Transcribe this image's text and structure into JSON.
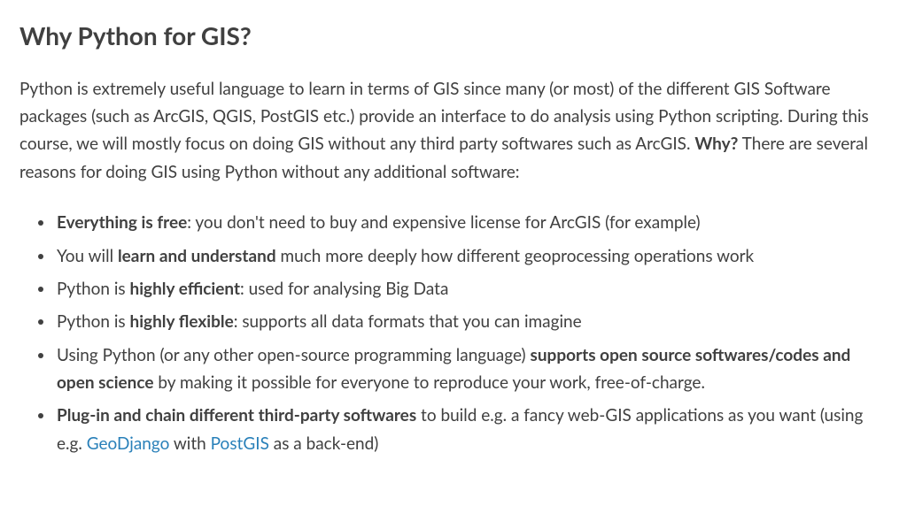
{
  "heading": "Why Python for GIS?",
  "intro": {
    "part1": "Python is extremely useful language to learn in terms of GIS since many (or most) of the different GIS Software packages (such as ArcGIS, QGIS, PostGIS etc.) provide an interface to do analysis using Python scripting. During this course, we will mostly focus on doing GIS without any third party softwares such as ArcGIS. ",
    "bold_why": "Why?",
    "part2": " There are several reasons for doing GIS using Python without any additional software:"
  },
  "bullets": {
    "b1": {
      "bold": "Everything is free",
      "rest": ": you don't need to buy and expensive license for ArcGIS (for example)"
    },
    "b2": {
      "pre": "You will ",
      "bold": "learn and understand",
      "rest": " much more deeply how different geoprocessing operations work"
    },
    "b3": {
      "pre": "Python is ",
      "bold": "highly efficient",
      "rest": ": used for analysing Big Data"
    },
    "b4": {
      "pre": "Python is ",
      "bold": "highly flexible",
      "rest": ": supports all data formats that you can imagine"
    },
    "b5": {
      "pre": "Using Python (or any other open-source programming language) ",
      "bold": "supports open source softwares/codes and open science",
      "rest": " by making it possible for everyone to reproduce your work, free-of-charge."
    },
    "b6": {
      "bold": "Plug-in and chain different third-party softwares",
      "mid1": " to build e.g. a fancy web-GIS applications as you want (using e.g. ",
      "link1": "GeoDjango",
      "mid2": " with ",
      "link2": "PostGIS",
      "rest": " as a back-end)"
    }
  }
}
